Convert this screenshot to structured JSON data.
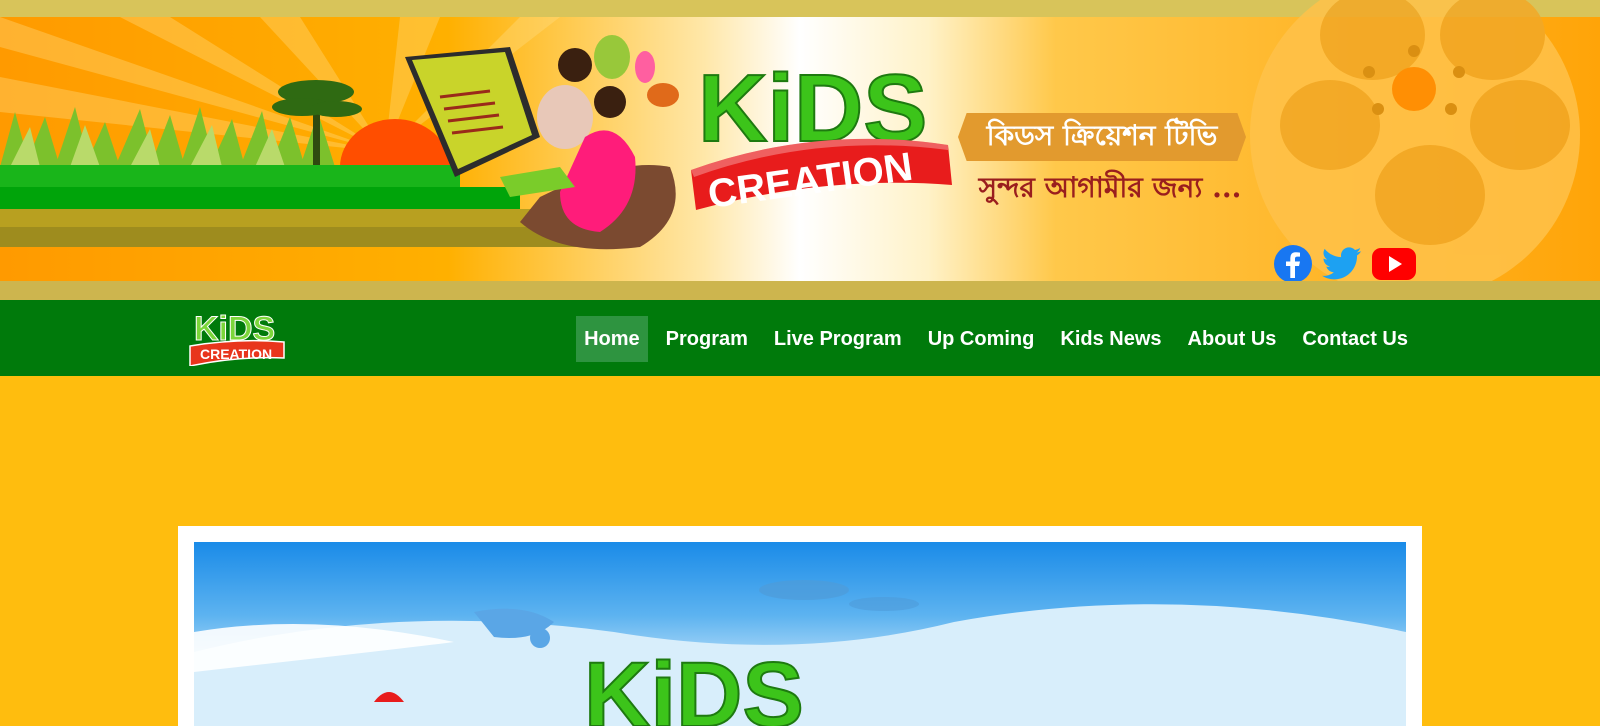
{
  "banner": {
    "brand_line1": "KiDS",
    "brand_line2": "CREATION",
    "tagline_bn": "কিডস ক্রিয়েশন টিভি",
    "subtitle_bn": "সুন্দর আগামীর জন্য ...",
    "social": [
      {
        "name": "facebook",
        "icon": "facebook-icon",
        "color": "#1877F2"
      },
      {
        "name": "twitter",
        "icon": "twitter-icon",
        "color": "#1DA1F2"
      },
      {
        "name": "youtube",
        "icon": "youtube-icon",
        "color": "#FF0000"
      }
    ]
  },
  "nav": {
    "logo_line1": "KiDS",
    "logo_line2": "CREATION",
    "items": [
      {
        "label": "Home",
        "active": true
      },
      {
        "label": "Program",
        "active": false
      },
      {
        "label": "Live Program",
        "active": false
      },
      {
        "label": "Up Coming",
        "active": false
      },
      {
        "label": "Kids News",
        "active": false
      },
      {
        "label": "About Us",
        "active": false
      },
      {
        "label": "Contact Us",
        "active": false
      }
    ]
  },
  "hero": {
    "logo_text": "KiDS"
  },
  "colors": {
    "page_bg": "#FFBD0E",
    "nav_bg": "#007A0B",
    "nav_active_bg": "#2E9440",
    "ribbon": "#E29A2E",
    "subtitle": "#9A1E1E"
  }
}
